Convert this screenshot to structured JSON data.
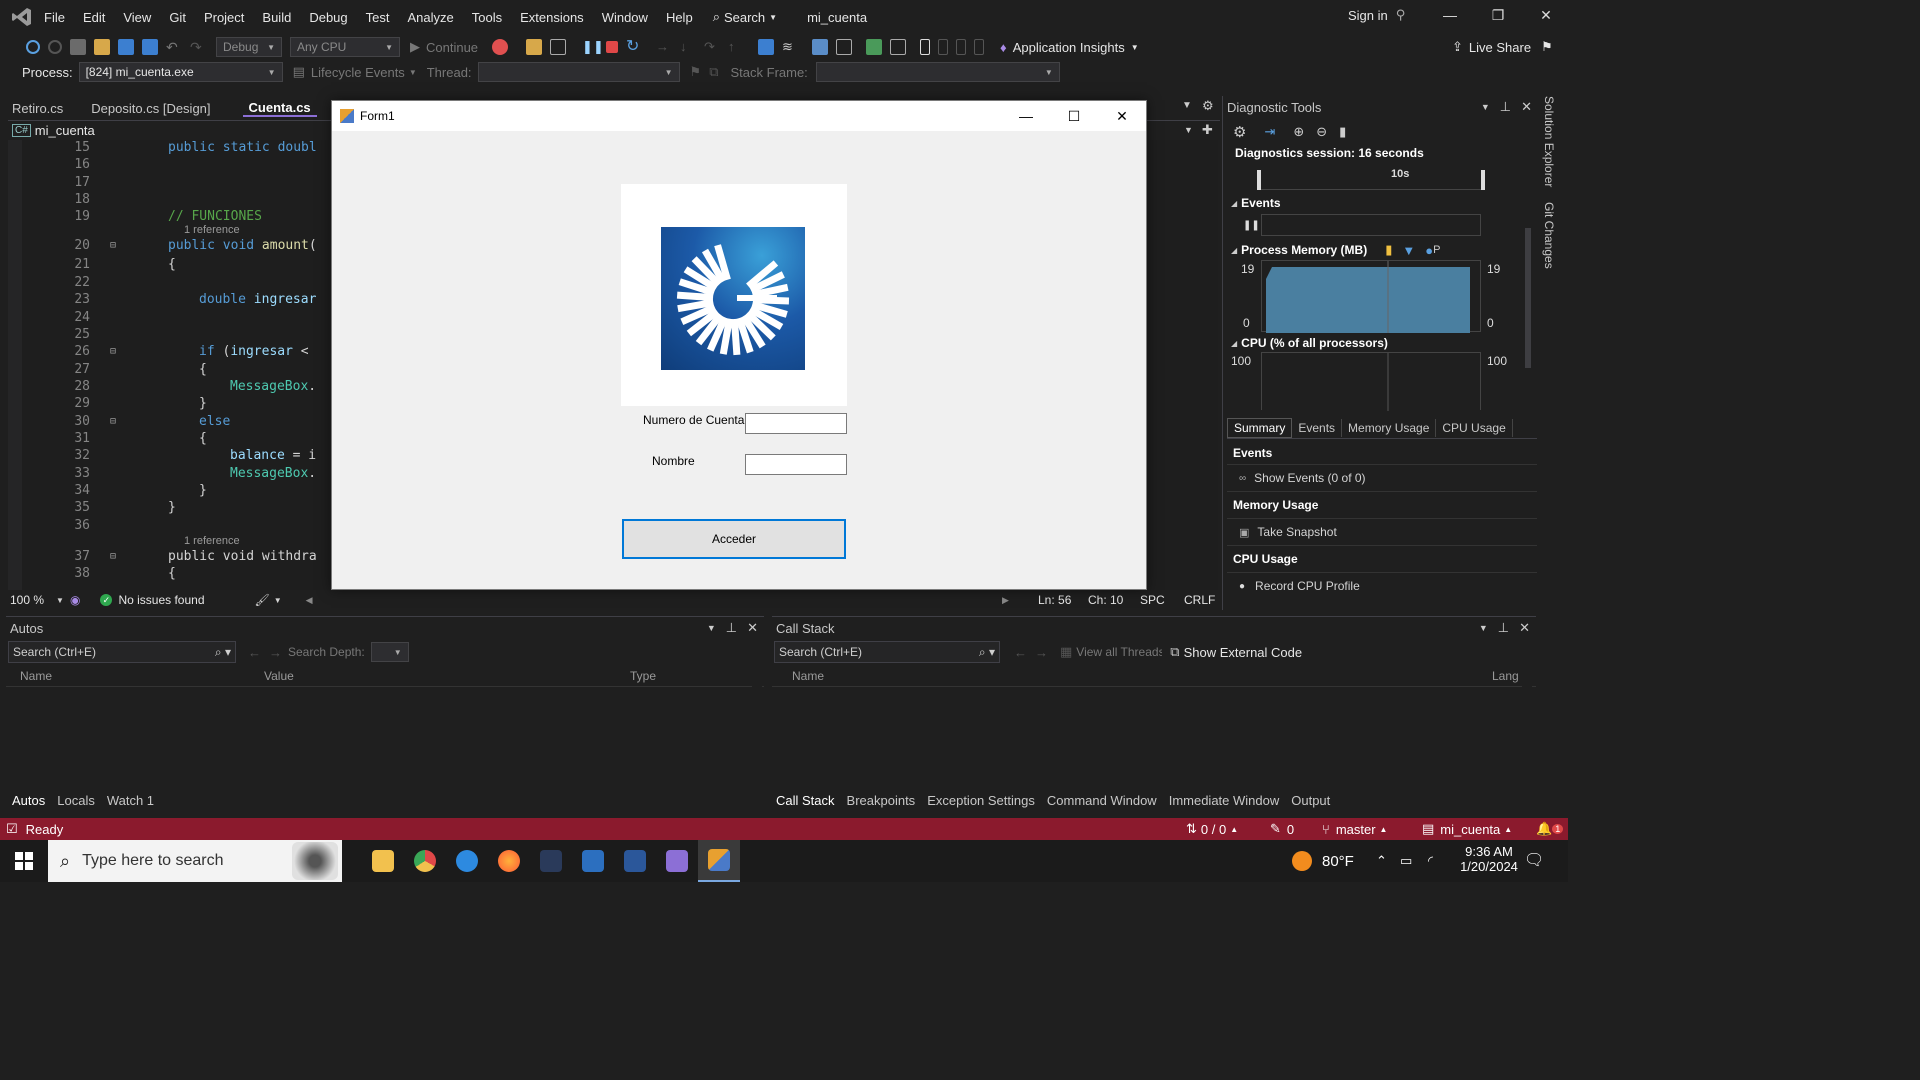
{
  "menu": {
    "items": [
      "File",
      "Edit",
      "View",
      "Git",
      "Project",
      "Build",
      "Debug",
      "Test",
      "Analyze",
      "Tools",
      "Extensions",
      "Window",
      "Help"
    ],
    "search_label": "Search",
    "solution_name": "mi_cuenta",
    "sign_in": "Sign in"
  },
  "toolbar": {
    "config": "Debug",
    "platform": "Any CPU",
    "continue_label": "Continue",
    "app_insights": "Application Insights",
    "live_share": "Live Share"
  },
  "procbar": {
    "process_label": "Process:",
    "process_value": "[824] mi_cuenta.exe",
    "lifecycle_label": "Lifecycle Events",
    "thread_label": "Thread:",
    "stack_frame_label": "Stack Frame:"
  },
  "tabs": [
    {
      "label": "Retiro.cs",
      "active": false
    },
    {
      "label": "Deposito.cs [Design]",
      "active": false
    },
    {
      "label": "Cuenta.cs",
      "active": true
    }
  ],
  "navbar": {
    "project": "mi_cuenta"
  },
  "code": {
    "lines": [
      {
        "n": "15",
        "text": "public static doubl"
      },
      {
        "n": "16",
        "text": ""
      },
      {
        "n": "17",
        "text": ""
      },
      {
        "n": "18",
        "text": ""
      },
      {
        "n": "19",
        "text": "// FUNCIONES"
      },
      {
        "n": "20",
        "text": "public void amount("
      },
      {
        "n": "21",
        "text": "{"
      },
      {
        "n": "22",
        "text": ""
      },
      {
        "n": "23",
        "text": "double ingresar"
      },
      {
        "n": "24",
        "text": ""
      },
      {
        "n": "25",
        "text": ""
      },
      {
        "n": "26",
        "text": "if (ingresar <"
      },
      {
        "n": "27",
        "text": "{"
      },
      {
        "n": "28",
        "text": "MessageBox."
      },
      {
        "n": "29",
        "text": "}"
      },
      {
        "n": "30",
        "text": "else"
      },
      {
        "n": "31",
        "text": "{"
      },
      {
        "n": "32",
        "text": "balance = i"
      },
      {
        "n": "33",
        "text": "MessageBox."
      },
      {
        "n": "34",
        "text": "}"
      },
      {
        "n": "35",
        "text": "}"
      },
      {
        "n": "36",
        "text": ""
      },
      {
        "n": "37",
        "text": "public void withdra"
      },
      {
        "n": "38",
        "text": "{"
      }
    ],
    "reference_label": "1 reference"
  },
  "editor_status": {
    "zoom": "100 %",
    "issues": "No issues found",
    "line": "Ln: 56",
    "col": "Ch: 10",
    "spc": "SPC",
    "eol": "CRLF"
  },
  "form1": {
    "title": "Form1",
    "account_label": "Numero de Cuenta",
    "account_value": "",
    "name_label": "Nombre",
    "name_value": "",
    "button_label": "Acceder"
  },
  "diagnostic": {
    "title": "Diagnostic Tools",
    "session": "Diagnostics session: 16 seconds",
    "timeline_tick": "10s",
    "events_header": "Events",
    "memory_header": "Process Memory (MB)",
    "memory_legend": "P",
    "memory_max": "19",
    "memory_min": "0",
    "cpu_header": "CPU (% of all processors)",
    "cpu_max": "100",
    "tabs": [
      "Summary",
      "Events",
      "Memory Usage",
      "CPU Usage"
    ],
    "summary": {
      "events_title": "Events",
      "show_events": "Show Events (0 of 0)",
      "memory_title": "Memory Usage",
      "take_snapshot": "Take Snapshot",
      "cpu_title": "CPU Usage",
      "record_cpu": "Record CPU Profile"
    },
    "side_tabs": [
      "Solution Explorer",
      "Git Changes"
    ]
  },
  "autos": {
    "title": "Autos",
    "search_placeholder": "Search (Ctrl+E)",
    "search_depth": "Search Depth:",
    "columns": [
      "Name",
      "Value",
      "Type"
    ],
    "tabs": [
      "Autos",
      "Locals",
      "Watch 1"
    ]
  },
  "callstack": {
    "title": "Call Stack",
    "search_placeholder": "Search (Ctrl+E)",
    "view_all_threads": "View all Threads",
    "show_external": "Show External Code",
    "columns": [
      "Name",
      "Lang"
    ],
    "tabs": [
      "Call Stack",
      "Breakpoints",
      "Exception Settings",
      "Command Window",
      "Immediate Window",
      "Output"
    ]
  },
  "statusbar": {
    "ready": "Ready",
    "changes": "0 / 0",
    "pencil_count": "0",
    "branch": "master",
    "repo": "mi_cuenta",
    "notifications": "1"
  },
  "taskbar": {
    "search_placeholder": "Type here to search",
    "weather": "80°F",
    "time": "9:36 AM",
    "date": "1/20/2024"
  },
  "colors": {
    "statusbar": "#8b1a2d",
    "accent": "#8c6fd6",
    "logo_blue": "#0f3d7a"
  }
}
